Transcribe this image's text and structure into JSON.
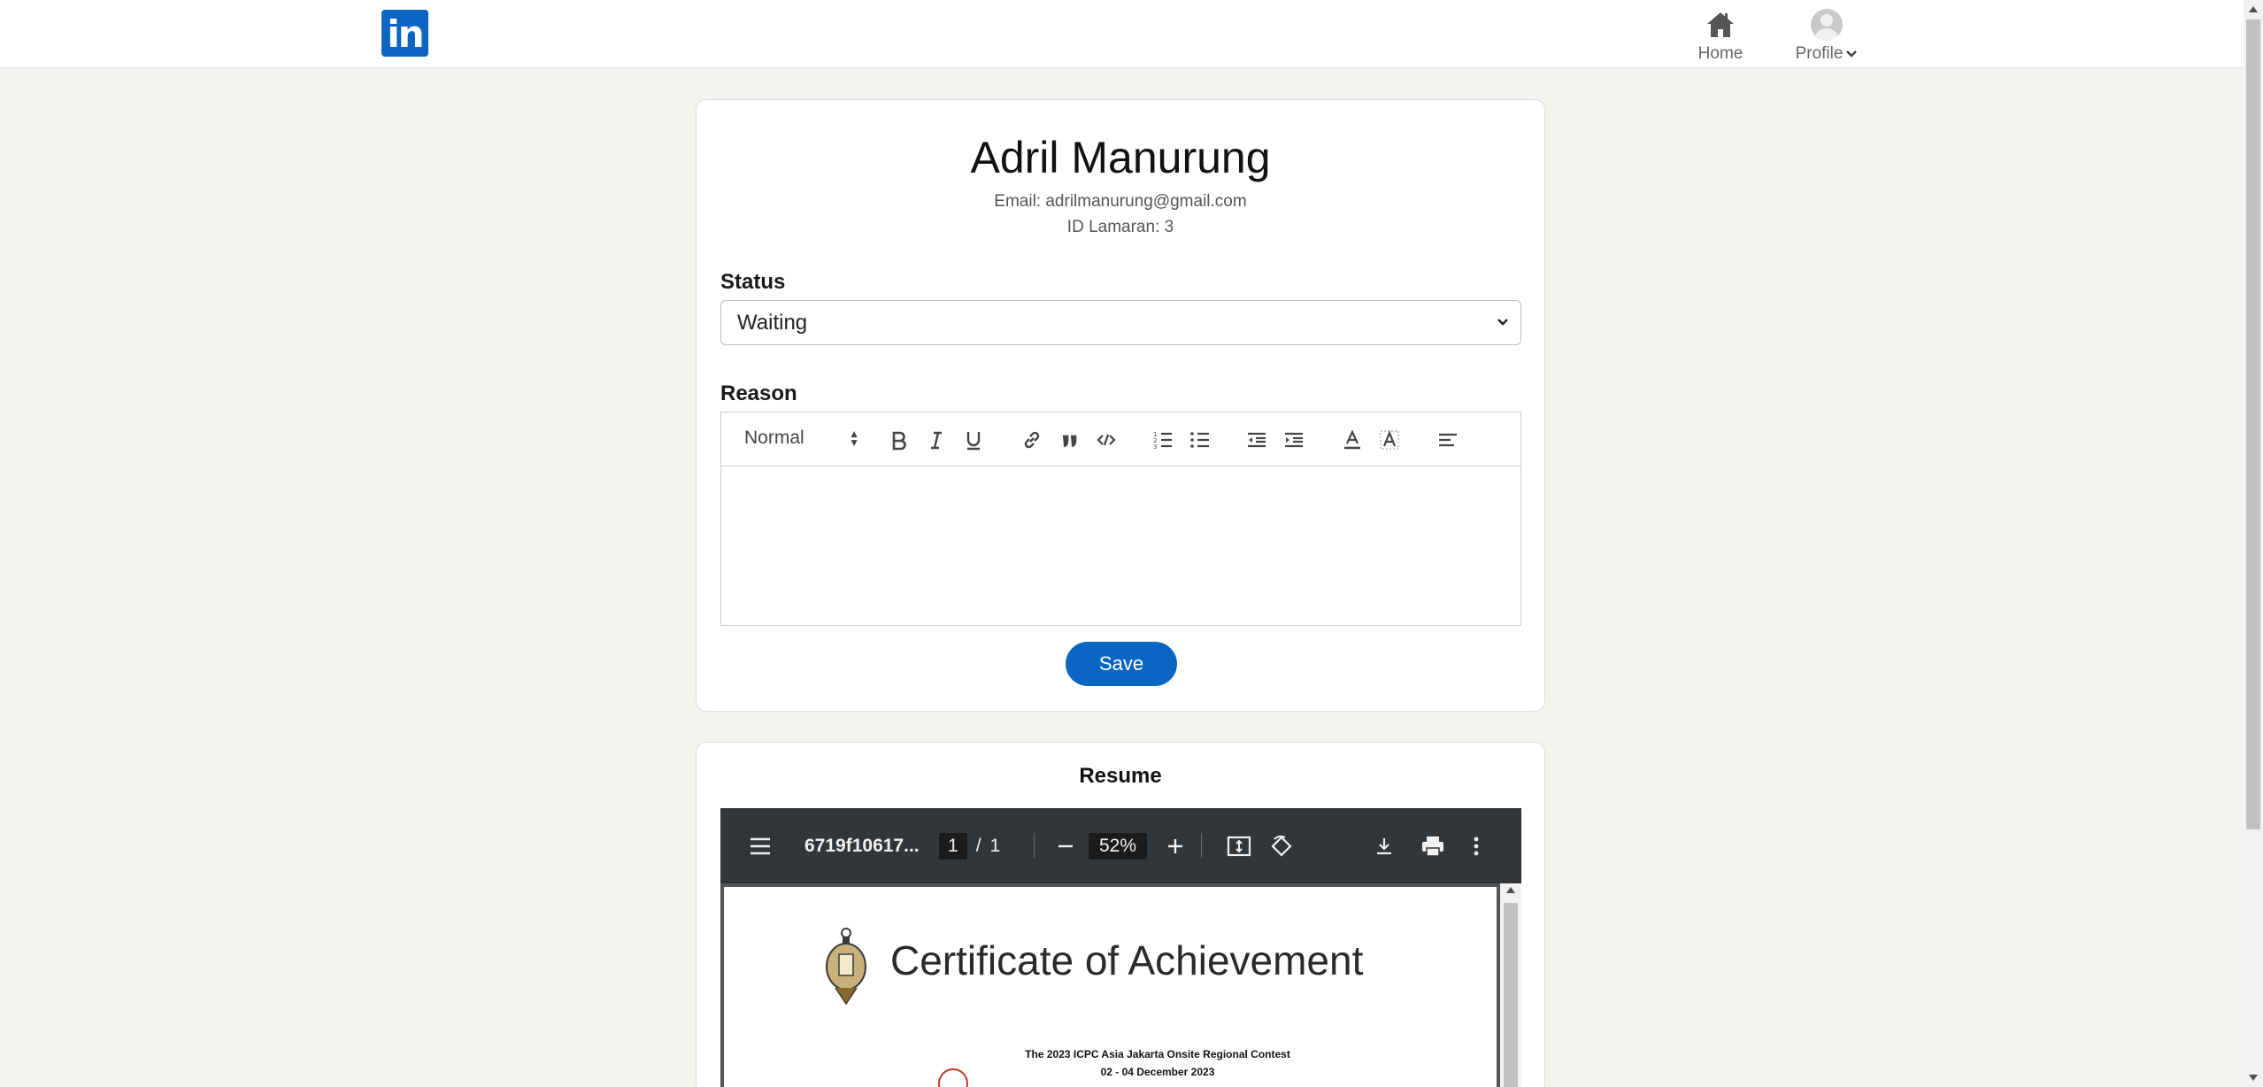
{
  "nav": {
    "logo_text": "in",
    "home_label": "Home",
    "profile_label": "Profile",
    "brand_color": "#0a66c2"
  },
  "application": {
    "name": "Adril Manurung",
    "email": "Email: adrilmanurung@gmail.com",
    "application_id": "ID Lamaran: 3",
    "status_label": "Status",
    "status_value": "Waiting",
    "reason_label": "Reason",
    "editor": {
      "format_picker": "Normal",
      "buttons": [
        "bold-icon",
        "italic-icon",
        "underline-icon",
        "link-icon",
        "blockquote-icon",
        "code-icon",
        "ordered-list-icon",
        "bullet-list-icon",
        "outdent-icon",
        "indent-icon",
        "text-color-icon",
        "background-color-icon",
        "align-icon"
      ]
    },
    "save_label": "Save"
  },
  "resume": {
    "title": "Resume",
    "pdf": {
      "filename": "6719f10617...",
      "current_page": "1",
      "page_separator": "/",
      "total_pages": "1",
      "zoom": "52%",
      "certificate_title": "Certificate of Achievement",
      "line1": "The 2023 ICPC Asia Jakarta Onsite Regional Contest",
      "line2": "02 - 04 December 2023"
    }
  }
}
